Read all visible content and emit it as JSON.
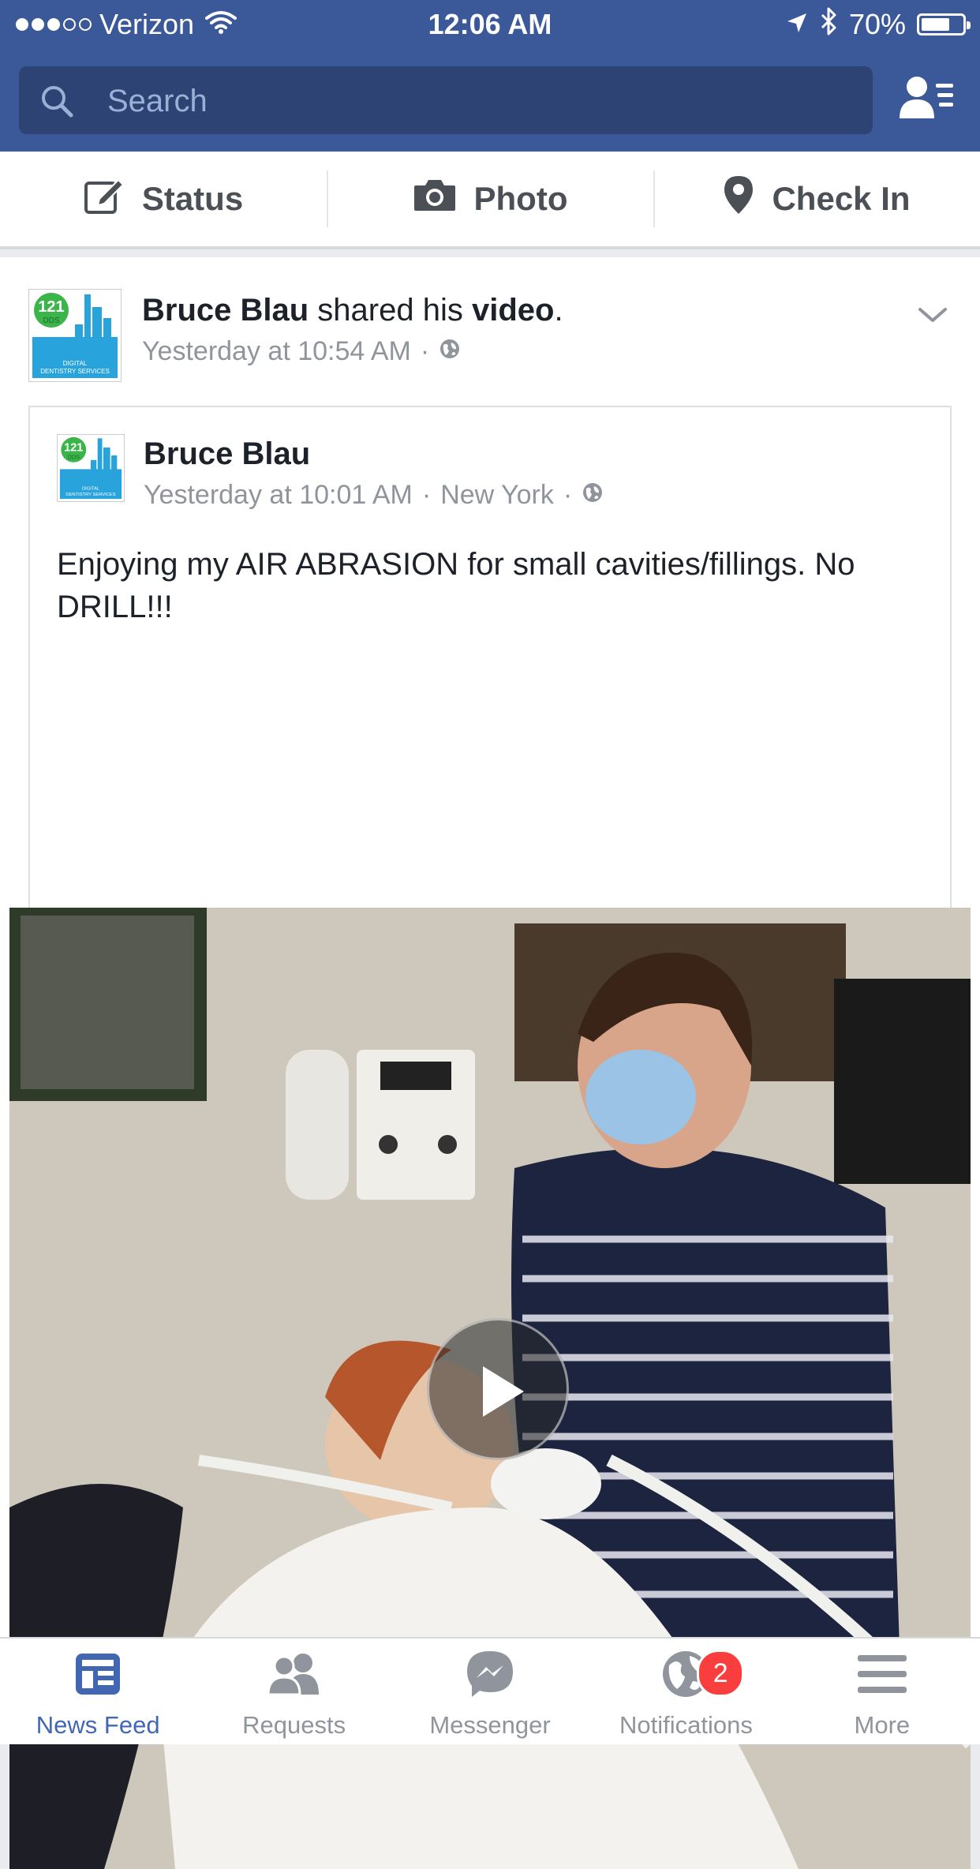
{
  "status_bar": {
    "carrier": "Verizon",
    "time": "12:06 AM",
    "battery": "70%",
    "battery_level": 0.7,
    "signal_bars_filled": 3,
    "signal_bars_total": 5
  },
  "search": {
    "placeholder": "Search"
  },
  "composer": {
    "status_label": "Status",
    "photo_label": "Photo",
    "checkin_label": "Check In"
  },
  "post": {
    "author": "Bruce Blau",
    "action": " shared his ",
    "object": "video",
    "suffix": ".",
    "time": "Yesterday at 10:54 AM",
    "separator": "·",
    "avatar_text": {
      "number": "121",
      "dds": "DDS",
      "caption_1": "DIGITAL",
      "caption_2": "DENTISTRY SERVICES"
    },
    "shared": {
      "author": "Bruce Blau",
      "time": "Yesterday at 10:01 AM",
      "location": "New York",
      "separator": "·",
      "text": "Enjoying my AIR ABRASION for small cavities/fillings. No DRILL!!!"
    }
  },
  "tabbar": {
    "items": [
      {
        "label": "News Feed",
        "icon": "news-feed-icon",
        "active": true
      },
      {
        "label": "Requests",
        "icon": "friend-requests-icon"
      },
      {
        "label": "Messenger",
        "icon": "messenger-icon"
      },
      {
        "label": "Notifications",
        "icon": "globe-icon",
        "badge": "2"
      },
      {
        "label": "More",
        "icon": "menu-icon"
      }
    ]
  },
  "colors": {
    "brand_blue": "#3b5998",
    "search_bg": "#2d4373",
    "active_tab": "#4267b2",
    "badge": "#fa3e3e",
    "meta_gray": "#90949c"
  }
}
